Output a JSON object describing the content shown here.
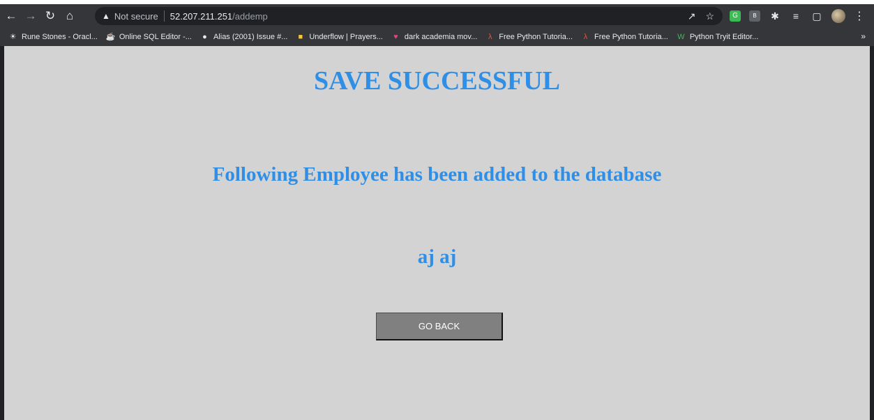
{
  "browser": {
    "security_label": "Not secure",
    "url_host": "52.207.211.251",
    "url_path": "/addemp",
    "bookmarks": [
      {
        "label": "Rune Stones - Oracl...",
        "icon": "sun-icon",
        "color": "#e8eaed"
      },
      {
        "label": "Online SQL Editor -...",
        "icon": "coffee-icon",
        "color": "#e8a33d"
      },
      {
        "label": "Alias (2001) Issue #...",
        "icon": "globe-icon",
        "color": "#e8eaed"
      },
      {
        "label": "Underflow | Prayers...",
        "icon": "underflow-icon",
        "color": "#f4c542"
      },
      {
        "label": "dark academia mov...",
        "icon": "heart-icon",
        "color": "#e0457b"
      },
      {
        "label": "Free Python Tutoria...",
        "icon": "python-tutorial-icon",
        "color": "#e0553d"
      },
      {
        "label": "Free Python Tutoria...",
        "icon": "python-tutorial-icon",
        "color": "#e0553d"
      },
      {
        "label": "Python Tryit Editor...",
        "icon": "w3schools-icon",
        "color": "#3cba54"
      }
    ]
  },
  "page": {
    "title": "SAVE SUCCESSFUL",
    "message": "Following Employee has been added to the database",
    "employee_name": "aj aj",
    "go_back_label": "GO BACK"
  },
  "colors": {
    "heading": "#2f8fe6",
    "page_background": "#d3d3d3",
    "button_background": "#808080"
  }
}
